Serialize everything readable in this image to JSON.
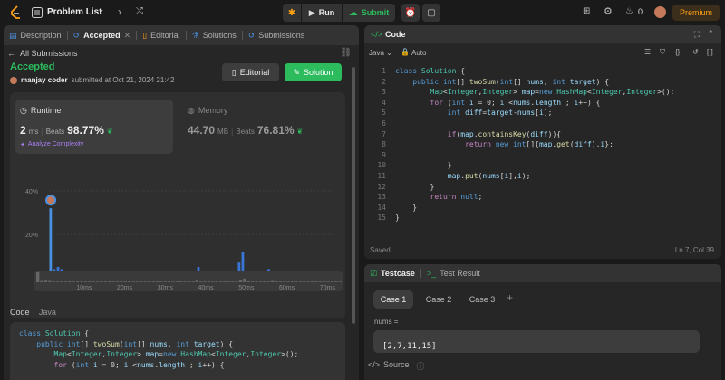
{
  "topbar": {
    "title": "Problem List",
    "run": "Run",
    "submit": "Submit",
    "streak": "0",
    "premium": "Premium"
  },
  "left": {
    "tabs": [
      "Description",
      "Accepted",
      "Editorial",
      "Solutions",
      "Submissions"
    ],
    "back": "All Submissions",
    "status": "Accepted",
    "user": "manjay coder",
    "submitted": "submitted at Oct 21, 2024 21:42",
    "editorial_btn": "Editorial",
    "solution_btn": "Solution",
    "runtime": {
      "label": "Runtime",
      "value": "2",
      "unit": "ms",
      "beats_label": "Beats",
      "beats": "98.77%"
    },
    "analyze": "Analyze Complexity",
    "memory": {
      "label": "Memory",
      "value": "44.70",
      "unit": "MB",
      "beats_label": "Beats",
      "beats": "76.81%"
    },
    "code_label": "Code",
    "lang_label": "Java"
  },
  "chart_data": {
    "type": "bar",
    "ylabels": [
      "40%",
      "20%",
      "0%"
    ],
    "ylim": [
      0,
      40
    ],
    "xlabels": [
      "10ms",
      "20ms",
      "30ms",
      "40ms",
      "50ms",
      "60ms",
      "70ms"
    ],
    "values": [
      32,
      4,
      5,
      4,
      2,
      2,
      2,
      2,
      2,
      2,
      2,
      2,
      2,
      2,
      2,
      2,
      2,
      2,
      2,
      2,
      2,
      2,
      2,
      2,
      2,
      2,
      2,
      2,
      2,
      2,
      2,
      2,
      2,
      2,
      2,
      2,
      2,
      2,
      2,
      2,
      5,
      2,
      2,
      2,
      2,
      2,
      2,
      2,
      2,
      2,
      2,
      7,
      12,
      3,
      2,
      2,
      2,
      2,
      2,
      4,
      2,
      2,
      2,
      2,
      2,
      2,
      2,
      2,
      2,
      2,
      2,
      2,
      2,
      2,
      2,
      2,
      2
    ],
    "highlight_index": 0
  },
  "code": {
    "title": "Code",
    "lang": "Java",
    "mode": "Auto",
    "lines": [
      [
        [
          "kw",
          "class "
        ],
        [
          "ty",
          "Solution"
        ],
        [
          "tx",
          " {"
        ]
      ],
      [
        [
          "tx",
          "    "
        ],
        [
          "kw",
          "public "
        ],
        [
          "kw",
          "int"
        ],
        [
          "tx",
          "[] "
        ],
        [
          "fn",
          "twoSum"
        ],
        [
          "tx",
          "("
        ],
        [
          "kw",
          "int"
        ],
        [
          "tx",
          "[] "
        ],
        [
          "vr",
          "nums"
        ],
        [
          "tx",
          ", "
        ],
        [
          "kw",
          "int "
        ],
        [
          "vr",
          "target"
        ],
        [
          "tx",
          ") {"
        ]
      ],
      [
        [
          "tx",
          "        "
        ],
        [
          "ty",
          "Map"
        ],
        [
          "tx",
          "<"
        ],
        [
          "ty",
          "Integer"
        ],
        [
          "tx",
          ","
        ],
        [
          "ty",
          "Integer"
        ],
        [
          "tx",
          "> "
        ],
        [
          "vr",
          "map"
        ],
        [
          "tx",
          "="
        ],
        [
          "kw",
          "new "
        ],
        [
          "ty",
          "HashMap"
        ],
        [
          "tx",
          "<"
        ],
        [
          "ty",
          "Integer"
        ],
        [
          "tx",
          ","
        ],
        [
          "ty",
          "Integer"
        ],
        [
          "tx",
          ">();"
        ]
      ],
      [
        [
          "tx",
          "        "
        ],
        [
          "ctl",
          "for "
        ],
        [
          "tx",
          "("
        ],
        [
          "kw",
          "int "
        ],
        [
          "vr",
          "i"
        ],
        [
          "tx",
          " = 0; "
        ],
        [
          "vr",
          "i"
        ],
        [
          "tx",
          " <"
        ],
        [
          "vr",
          "nums"
        ],
        [
          "tx",
          "."
        ],
        [
          "vr",
          "length"
        ],
        [
          "tx",
          " ; "
        ],
        [
          "vr",
          "i"
        ],
        [
          "tx",
          "++) {"
        ]
      ],
      [
        [
          "tx",
          "            "
        ],
        [
          "kw",
          "int "
        ],
        [
          "vr",
          "diff"
        ],
        [
          "tx",
          "="
        ],
        [
          "vr",
          "target"
        ],
        [
          "tx",
          "-"
        ],
        [
          "vr",
          "nums"
        ],
        [
          "tx",
          "["
        ],
        [
          "vr",
          "i"
        ],
        [
          "tx",
          "];"
        ]
      ],
      [
        [
          "tx",
          ""
        ]
      ],
      [
        [
          "tx",
          "            "
        ],
        [
          "ctl",
          "if"
        ],
        [
          "tx",
          "("
        ],
        [
          "vr",
          "map"
        ],
        [
          "tx",
          "."
        ],
        [
          "fn",
          "containsKey"
        ],
        [
          "tx",
          "("
        ],
        [
          "vr",
          "diff"
        ],
        [
          "tx",
          ")){"
        ]
      ],
      [
        [
          "tx",
          "                "
        ],
        [
          "ctl",
          "return "
        ],
        [
          "kw",
          "new "
        ],
        [
          "kw",
          "int"
        ],
        [
          "tx",
          "[]{"
        ],
        [
          "vr",
          "map"
        ],
        [
          "tx",
          "."
        ],
        [
          "fn",
          "get"
        ],
        [
          "tx",
          "("
        ],
        [
          "vr",
          "diff"
        ],
        [
          "tx",
          "),"
        ],
        [
          "vr",
          "i"
        ],
        [
          "tx",
          "};"
        ]
      ],
      [
        [
          "tx",
          ""
        ]
      ],
      [
        [
          "tx",
          "            }"
        ]
      ],
      [
        [
          "tx",
          "            "
        ],
        [
          "vr",
          "map"
        ],
        [
          "tx",
          "."
        ],
        [
          "fn",
          "put"
        ],
        [
          "tx",
          "("
        ],
        [
          "vr",
          "nums"
        ],
        [
          "tx",
          "["
        ],
        [
          "vr",
          "i"
        ],
        [
          "tx",
          "],"
        ],
        [
          "vr",
          "i"
        ],
        [
          "tx",
          ");"
        ]
      ],
      [
        [
          "tx",
          "        }"
        ]
      ],
      [
        [
          "tx",
          "        "
        ],
        [
          "ctl",
          "return "
        ],
        [
          "kw",
          "null"
        ],
        [
          "tx",
          ";"
        ]
      ],
      [
        [
          "tx",
          "    }"
        ]
      ],
      [
        [
          "tx",
          "}"
        ]
      ]
    ],
    "line_numbers": [
      "1",
      "2",
      "3",
      "4",
      "5",
      "6",
      "7",
      "8",
      "9",
      "10",
      "11",
      "12",
      "13",
      "14",
      "15"
    ],
    "saved": "Saved",
    "position": "Ln 7, Col 39"
  },
  "left_code": [
    [
      [
        "kw",
        "class "
      ],
      [
        "ty",
        "Solution"
      ],
      [
        "tx",
        " {"
      ]
    ],
    [
      [
        "tx",
        "    "
      ],
      [
        "kw",
        "public "
      ],
      [
        "kw",
        "int"
      ],
      [
        "tx",
        "[] "
      ],
      [
        "fn",
        "twoSum"
      ],
      [
        "tx",
        "("
      ],
      [
        "kw",
        "int"
      ],
      [
        "tx",
        "[] "
      ],
      [
        "vr",
        "nums"
      ],
      [
        "tx",
        ", "
      ],
      [
        "kw",
        "int "
      ],
      [
        "vr",
        "target"
      ],
      [
        "tx",
        ") {"
      ]
    ],
    [
      [
        "tx",
        "        "
      ],
      [
        "ty",
        "Map"
      ],
      [
        "tx",
        "<"
      ],
      [
        "ty",
        "Integer"
      ],
      [
        "tx",
        ","
      ],
      [
        "ty",
        "Integer"
      ],
      [
        "tx",
        "> "
      ],
      [
        "vr",
        "map"
      ],
      [
        "tx",
        "="
      ],
      [
        "kw",
        "new "
      ],
      [
        "ty",
        "HashMap"
      ],
      [
        "tx",
        "<"
      ],
      [
        "ty",
        "Integer"
      ],
      [
        "tx",
        ","
      ],
      [
        "ty",
        "Integer"
      ],
      [
        "tx",
        ">();"
      ]
    ],
    [
      [
        "tx",
        "        "
      ],
      [
        "ctl",
        "for "
      ],
      [
        "tx",
        "("
      ],
      [
        "kw",
        "int "
      ],
      [
        "vr",
        "i"
      ],
      [
        "tx",
        " = 0; "
      ],
      [
        "vr",
        "i"
      ],
      [
        "tx",
        " <"
      ],
      [
        "vr",
        "nums"
      ],
      [
        "tx",
        "."
      ],
      [
        "vr",
        "length"
      ],
      [
        "tx",
        " ; "
      ],
      [
        "vr",
        "i"
      ],
      [
        "tx",
        "++) {"
      ]
    ]
  ],
  "testcase": {
    "tab1": "Testcase",
    "tab2": "Test Result",
    "cases": [
      "Case 1",
      "Case 2",
      "Case 3"
    ],
    "add": "+",
    "var": "nums =",
    "value": "[2,7,11,15]",
    "source": "Source"
  },
  "colors": {
    "accent_green": "#2cbb5d",
    "premium": "#ffa116",
    "tab_blue": "#4a90e2"
  }
}
